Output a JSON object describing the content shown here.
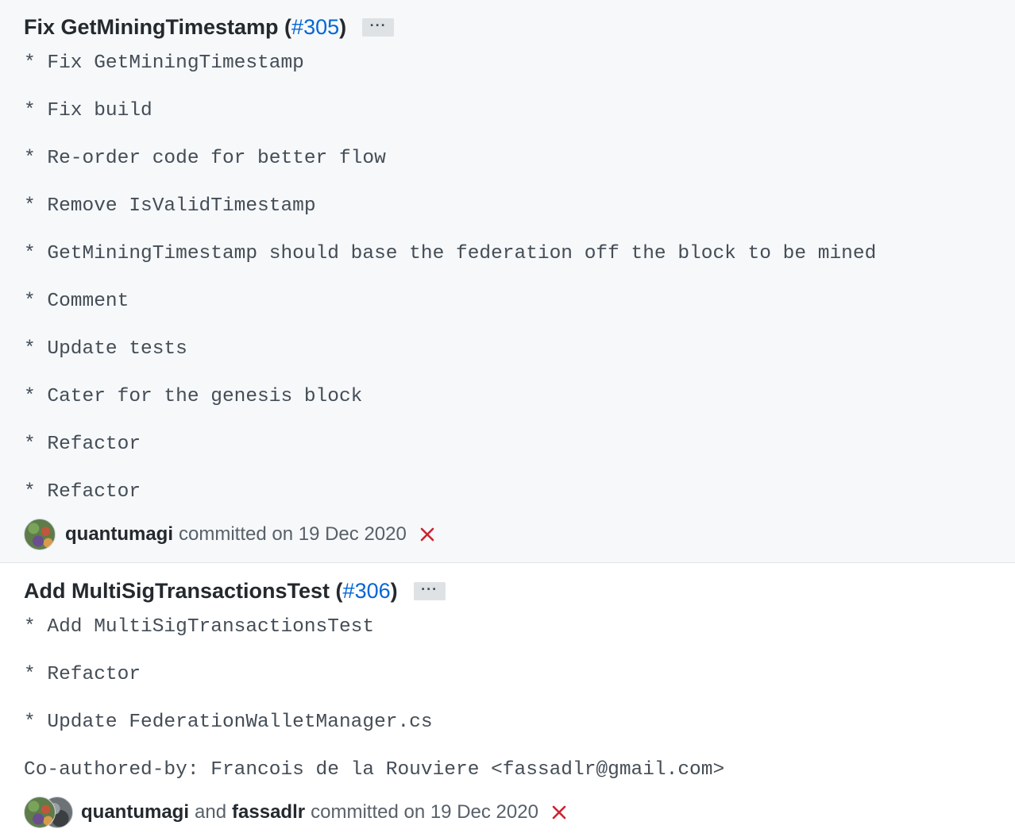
{
  "commits": [
    {
      "title": "Fix GetMiningTimestamp (",
      "pr": "#305",
      "title_close": ")",
      "ellipsis": "···",
      "message_lines": [
        "* Fix GetMiningTimestamp",
        "* Fix build",
        "* Re-order code for better flow",
        "* Remove IsValidTimestamp",
        "* GetMiningTimestamp should base the federation off the block to be mined",
        "* Comment",
        "* Update tests",
        "* Cater for the genesis block",
        "* Refactor",
        "* Refactor"
      ],
      "author": "quantumagi",
      "committed_text": "committed on 19 Dec 2020",
      "status_icon": "x-icon",
      "status_color": "#cb2431"
    },
    {
      "title": "Add MultiSigTransactionsTest (",
      "pr": "#306",
      "title_close": ")",
      "ellipsis": "···",
      "message_lines": [
        "* Add MultiSigTransactionsTest",
        "* Refactor",
        "* Update FederationWalletManager.cs",
        "Co-authored-by: Francois de la Rouviere <fassadlr@gmail.com>"
      ],
      "author": "quantumagi",
      "and_text": "and",
      "coauthor": "fassadlr",
      "committed_text": "committed on 19 Dec 2020",
      "status_icon": "x-icon",
      "status_color": "#cb2431"
    }
  ],
  "colors": {
    "link": "#0366d6",
    "text_dark": "#24292e",
    "text_muted": "#586069",
    "highlight_bg": "#f6f8fa"
  }
}
